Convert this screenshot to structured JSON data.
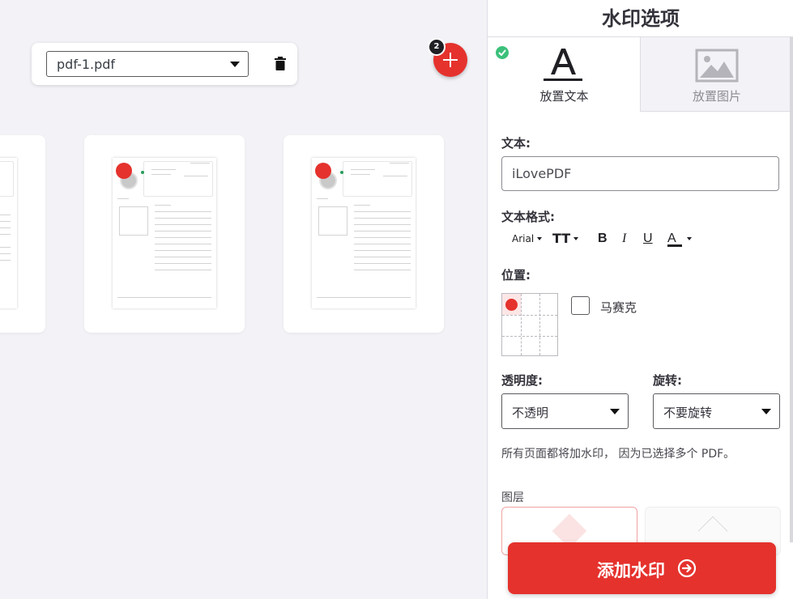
{
  "workarea": {
    "file_select_value": "pdf-1.pdf",
    "file_count": "2"
  },
  "panel": {
    "title": "水印选项",
    "tabs": [
      {
        "label": "放置文本",
        "active": true
      },
      {
        "label": "放置图片",
        "active": false
      }
    ],
    "text_label": "文本:",
    "text_value": "iLovePDF",
    "format_label": "文本格式:",
    "format": {
      "font": "Arial",
      "size_glyph": "TT",
      "bold": "B",
      "italic": "I",
      "underline": "U",
      "color": "A"
    },
    "position_label": "位置:",
    "mosaic_label": "马赛克",
    "transparency_label": "透明度:",
    "transparency_value": "不透明",
    "rotation_label": "旋转:",
    "rotation_value": "不要旋转",
    "note": "所有页面都将加水印， 因为已选择多个 PDF。",
    "layer_label": "图层",
    "cta_label": "添加水印"
  },
  "colors": {
    "accent": "#e5322d",
    "success": "#3cc07a"
  }
}
